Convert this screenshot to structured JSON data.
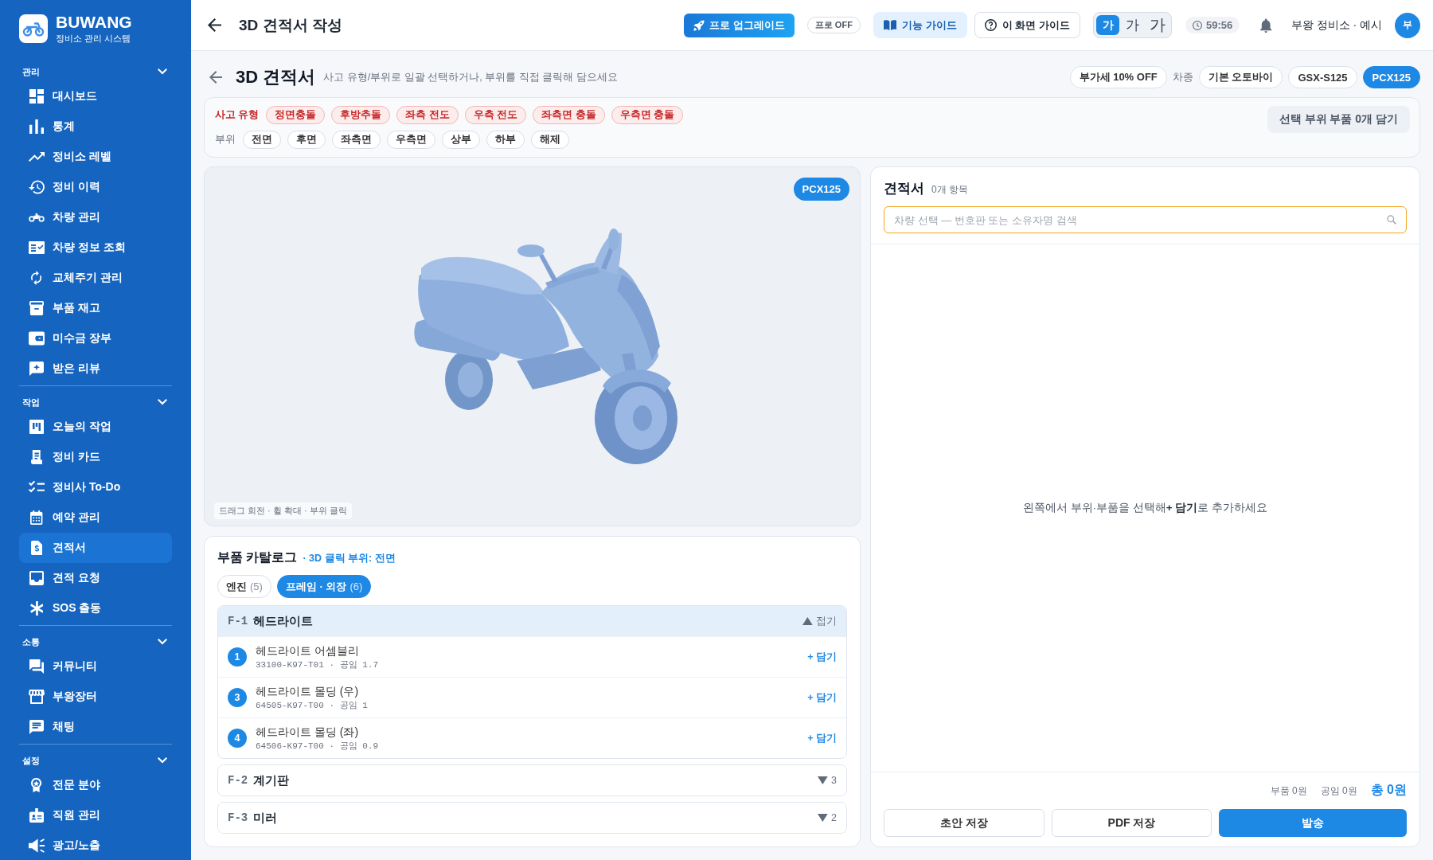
{
  "sidebar": {
    "logo": {
      "title": "BUWANG",
      "subtitle": "정비소 관리 시스템"
    },
    "sections": [
      {
        "title": "관리",
        "expanded": true,
        "items": [
          {
            "label": "대시보드",
            "selected": false
          },
          {
            "label": "통계",
            "selected": false
          },
          {
            "label": "정비소 레벨",
            "selected": false
          },
          {
            "label": "정비 이력",
            "selected": false
          },
          {
            "label": "차량 관리",
            "selected": false
          },
          {
            "label": "차량 정보 조회",
            "selected": false
          },
          {
            "label": "교체주기 관리",
            "selected": false
          },
          {
            "label": "부품 재고",
            "selected": false
          },
          {
            "label": "미수금 장부",
            "selected": false
          },
          {
            "label": "받은 리뷰",
            "selected": false
          }
        ]
      },
      {
        "title": "작업",
        "expanded": true,
        "items": [
          {
            "label": "오늘의 작업",
            "selected": false
          },
          {
            "label": "정비 카드",
            "selected": false
          },
          {
            "label": "정비사 To-Do",
            "selected": false
          },
          {
            "label": "예약 관리",
            "selected": false
          },
          {
            "label": "견적서",
            "selected": true
          },
          {
            "label": "견적 요청",
            "selected": false
          },
          {
            "label": "SOS 출동",
            "selected": false
          }
        ]
      },
      {
        "title": "소통",
        "expanded": true,
        "items": [
          {
            "label": "커뮤니티",
            "selected": false
          },
          {
            "label": "부왕장터",
            "selected": false
          },
          {
            "label": "채팅",
            "selected": false
          }
        ]
      },
      {
        "title": "설정",
        "expanded": true,
        "items": [
          {
            "label": "전문 분야",
            "selected": false
          },
          {
            "label": "직원 관리",
            "selected": false
          },
          {
            "label": "광고/노출",
            "selected": false
          }
        ]
      }
    ]
  },
  "top_bar": {
    "title": "3D 견적서 작성",
    "upgrade_button": "프로 업그레이드",
    "pro_status": "프로 OFF",
    "feature_guide_button": "기능 가이드",
    "screen_guide_button": "이 화면 가이드",
    "font_sizes": [
      {
        "label": "가",
        "selected": true
      },
      {
        "label": "가",
        "selected": false
      },
      {
        "label": "가",
        "selected": false
      }
    ],
    "timer": "59:56",
    "shop_name": "부왕 정비소 · 예시",
    "avatar": "부"
  },
  "page_header": {
    "title": "3D 견적서",
    "subtitle": "사고 유형/부위로 일괄 선택하거나, 부위를 직접 클릭해 담으세요",
    "vat_button": "부가세 10% OFF",
    "model_label": "차종",
    "models": [
      {
        "label": "기본 오토바이",
        "selected": false
      },
      {
        "label": "GSX-S125",
        "selected": false
      },
      {
        "label": "PCX125",
        "selected": true
      }
    ]
  },
  "filters": {
    "accident_label": "사고 유형",
    "accident_types": [
      {
        "label": "정면충돌",
        "selected": false
      },
      {
        "label": "후방추돌",
        "selected": false
      },
      {
        "label": "좌측 전도",
        "selected": false
      },
      {
        "label": "우측 전도",
        "selected": false
      },
      {
        "label": "좌측면 충돌",
        "selected": false
      },
      {
        "label": "우측면 충돌",
        "selected": false
      }
    ],
    "part_label": "부위",
    "parts": [
      {
        "label": "전면",
        "selected": false
      },
      {
        "label": "후면",
        "selected": false
      },
      {
        "label": "좌측면",
        "selected": false
      },
      {
        "label": "우측면",
        "selected": false
      },
      {
        "label": "상부",
        "selected": false
      },
      {
        "label": "하부",
        "selected": false
      },
      {
        "label": "해제",
        "selected": false
      }
    ],
    "add_button": "선택 부위 부품 0개 담기"
  },
  "viewer": {
    "model_badge": "PCX125",
    "hint": "드래그 회전 · 휠 확대 · 부위 클릭"
  },
  "catalog": {
    "title": "부품 카탈로그",
    "context": "· 3D 클릭 부위: 전면",
    "tabs": [
      {
        "label": "엔진",
        "count": "(5)",
        "selected": false
      },
      {
        "label": "프레임 · 외장",
        "count": "(6)",
        "selected": true
      }
    ],
    "groups": [
      {
        "code": "F-1",
        "name": "헤드라이트",
        "expanded": true,
        "toggle": "접기",
        "parts": [
          {
            "number": "1",
            "name": "헤드라이트 어셈블리",
            "detail": "33100-K97-T01 · 공임 1.7",
            "action": "+ 담기"
          },
          {
            "number": "3",
            "name": "헤드라이트 몰딩 (우)",
            "detail": "64505-K97-T00 · 공임 1",
            "action": "+ 담기"
          },
          {
            "number": "4",
            "name": "헤드라이트 몰딩 (좌)",
            "detail": "64506-K97-T00 · 공임 0.9",
            "action": "+ 담기"
          }
        ]
      },
      {
        "code": "F-2",
        "name": "계기판",
        "expanded": false,
        "toggle": "3"
      },
      {
        "code": "F-3",
        "name": "미러",
        "expanded": false,
        "toggle": "2"
      }
    ]
  },
  "quote": {
    "title": "견적서",
    "count": "0개 항목",
    "search": {
      "placeholder": "차량 선택 — 번호판 또는 소유자명 검색"
    },
    "empty_message": "왼쪽에서 부위·부품을 선택해**+ 담기**로 추가하세요",
    "parts_total": "부품 0원",
    "labor_total": "공임 0원",
    "grand_total": "총 0원",
    "buttons": [
      {
        "label": "초안 저장",
        "kind": "outline"
      },
      {
        "label": "PDF 저장",
        "kind": "outline"
      },
      {
        "label": "발송",
        "kind": "primary"
      }
    ]
  }
}
